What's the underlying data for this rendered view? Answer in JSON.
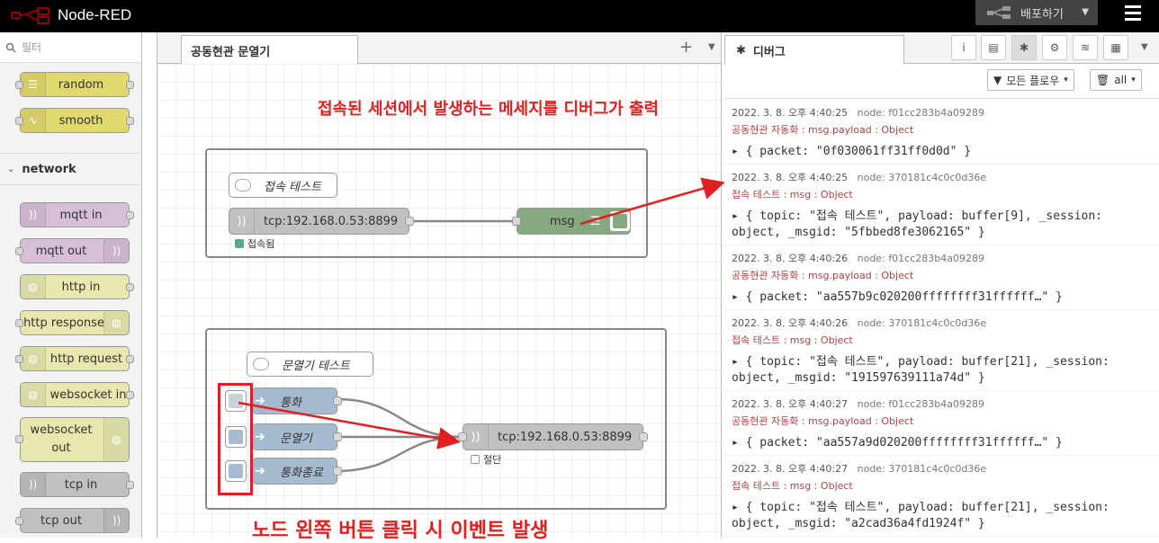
{
  "header": {
    "app_name": "Node-RED",
    "deploy_label": "배포하기"
  },
  "palette": {
    "search_placeholder": "필터",
    "category": "network",
    "nodes": [
      {
        "label": "random",
        "color": "#e2d96e"
      },
      {
        "label": "smooth",
        "color": "#e2d96e"
      },
      {
        "label": "mqtt in",
        "color": "#d8bfd8"
      },
      {
        "label": "mqtt out",
        "color": "#d8bfd8"
      },
      {
        "label": "http in",
        "color": "#e7e7ae"
      },
      {
        "label": "http response",
        "color": "#e7e7ae"
      },
      {
        "label": "http request",
        "color": "#e7e7ae"
      },
      {
        "label": "websocket in",
        "color": "#e7e7ae"
      },
      {
        "label": "websocket out",
        "color": "#e7e7ae"
      },
      {
        "label": "tcp in",
        "color": "#c0c0c0"
      },
      {
        "label": "tcp out",
        "color": "#c0c0c0"
      }
    ]
  },
  "workspace": {
    "tab_label": "공동현관 문열기",
    "comment1": "접속 테스트",
    "tcp_in_label": "tcp:192.168.0.53:8899",
    "tcp_in_status": "접속됨",
    "debug_label": "msg",
    "comment2": "문열기 테스트",
    "inject1": "통화",
    "inject2": "문열기",
    "inject3": "통화종료",
    "tcp_out_label": "tcp:192.168.0.53:8899",
    "tcp_out_status": "절단",
    "annotation_top": "접속된 세션에서 발생하는 메세지를 디버그가 출력",
    "annotation_bottom": "노드 왼쪽 버튼 클릭 시 이벤트 발생"
  },
  "sidebar": {
    "tab_label": "디버그",
    "filter_label": "모든 플로우",
    "clear_label": "all",
    "messages": [
      {
        "time": "2022. 3. 8. 오후 4:40:25",
        "node": "node: f01cc283b4a09289",
        "path": "공동현관 자동화 : msg.payload : Object",
        "line1": "{ packet: \"0f030061ff31ff0d0d\" }",
        "line2": ""
      },
      {
        "time": "2022. 3. 8. 오후 4:40:25",
        "node": "node: 370181c4c0c0d36e",
        "path": "접속 테스트 : msg : Object",
        "line1": "{ topic: \"접속 테스트\", payload: buffer[9], _session:",
        "line2": "object, _msgid: \"5fbbed8fe3062165\" }"
      },
      {
        "time": "2022. 3. 8. 오후 4:40:26",
        "node": "node: f01cc283b4a09289",
        "path": "공동현관 자동화 : msg.payload : Object",
        "line1": "{ packet: \"aa557b9c020200ffffffff31ffffff…\" }",
        "line2": ""
      },
      {
        "time": "2022. 3. 8. 오후 4:40:26",
        "node": "node: 370181c4c0c0d36e",
        "path": "접속 테스트 : msg : Object",
        "line1": "{ topic: \"접속 테스트\", payload: buffer[21], _session:",
        "line2": "object, _msgid: \"191597639111a74d\" }"
      },
      {
        "time": "2022. 3. 8. 오후 4:40:27",
        "node": "node: f01cc283b4a09289",
        "path": "공동현관 자동화 : msg.payload : Object",
        "line1": "{ packet: \"aa557a9d020200ffffffff31ffffff…\" }",
        "line2": ""
      },
      {
        "time": "2022. 3. 8. 오후 4:40:27",
        "node": "node: 370181c4c0c0d36e",
        "path": "접속 테스트 : msg : Object",
        "line1": "{ topic: \"접속 테스트\", payload: buffer[21], _session:",
        "line2": "object, _msgid: \"a2cad36a4fd1924f\" }"
      }
    ]
  }
}
